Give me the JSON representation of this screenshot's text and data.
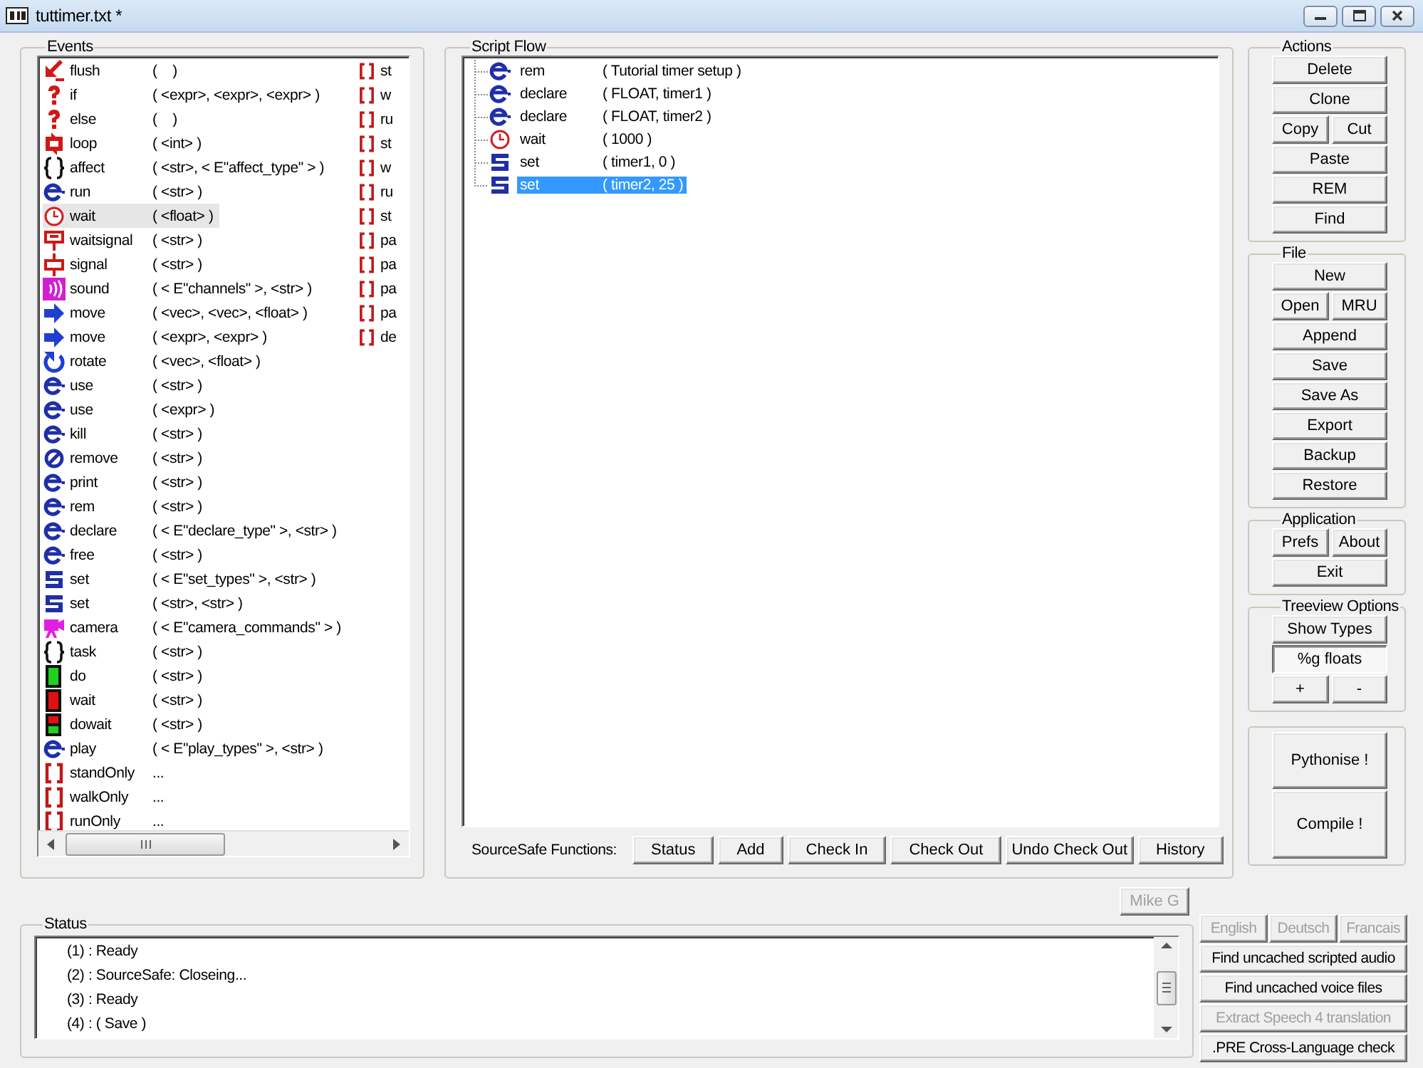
{
  "window": {
    "title": "tuttimer.txt *"
  },
  "events": {
    "title": "Events",
    "columns": [
      {
        "items": [
          {
            "kind": "flush",
            "name": "flush",
            "args": "(    )",
            "selected": false
          },
          {
            "kind": "question",
            "name": "if",
            "args": "( <expr>, <expr>, <expr> )",
            "selected": false
          },
          {
            "kind": "question",
            "name": "else",
            "args": "(    )",
            "selected": false
          },
          {
            "kind": "loop",
            "name": "loop",
            "args": "( <int> )",
            "selected": false
          },
          {
            "kind": "braces",
            "name": "affect",
            "args": "( <str>, < E\"affect_type\" > )",
            "selected": false
          },
          {
            "kind": "e",
            "name": "run",
            "args": "( <str> )",
            "selected": false
          },
          {
            "kind": "clock",
            "name": "wait",
            "args": "( <float> )",
            "selected": true
          },
          {
            "kind": "waitsignal",
            "name": "waitsignal",
            "args": "( <str> )",
            "selected": false
          },
          {
            "kind": "signal",
            "name": "signal",
            "args": "( <str> )",
            "selected": false
          },
          {
            "kind": "sound",
            "name": "sound",
            "args": "( < E\"channels\" >, <str> )",
            "selected": false
          },
          {
            "kind": "arrow",
            "name": "move",
            "args": "( <vec>, <vec>, <float> )",
            "selected": false
          },
          {
            "kind": "arrow",
            "name": "move",
            "args": "( <expr>, <expr> )",
            "selected": false
          },
          {
            "kind": "rotate",
            "name": "rotate",
            "args": "( <vec>, <float> )",
            "selected": false
          },
          {
            "kind": "e",
            "name": "use",
            "args": "( <str> )",
            "selected": false
          },
          {
            "kind": "e",
            "name": "use",
            "args": "( <expr> )",
            "selected": false
          },
          {
            "kind": "e",
            "name": "kill",
            "args": "( <str> )",
            "selected": false
          },
          {
            "kind": "remove",
            "name": "remove",
            "args": "( <str> )",
            "selected": false
          },
          {
            "kind": "e",
            "name": "print",
            "args": "( <str> )",
            "selected": false
          },
          {
            "kind": "e",
            "name": "rem",
            "args": "( <str> )",
            "selected": false
          },
          {
            "kind": "e",
            "name": "declare",
            "args": "( < E\"declare_type\" >, <str> )",
            "selected": false
          },
          {
            "kind": "e",
            "name": "free",
            "args": "( <str> )",
            "selected": false
          },
          {
            "kind": "set",
            "name": "set",
            "args": "( < E\"set_types\" >, <str> )",
            "selected": false
          },
          {
            "kind": "set",
            "name": "set",
            "args": "( <str>, <str> )",
            "selected": false
          },
          {
            "kind": "camera",
            "name": "camera",
            "args": "( < E\"camera_commands\" > )",
            "selected": false
          },
          {
            "kind": "braces",
            "name": "task",
            "args": "( <str> )",
            "selected": false
          },
          {
            "kind": "go",
            "name": "do",
            "args": "( <str> )",
            "selected": false
          },
          {
            "kind": "stop",
            "name": "wait",
            "args": "( <str> )",
            "selected": false
          },
          {
            "kind": "gostop",
            "name": "dowait",
            "args": "( <str> )",
            "selected": false
          },
          {
            "kind": "e",
            "name": "play",
            "args": "( < E\"play_types\" >, <str> )",
            "selected": false
          },
          {
            "kind": "bracket",
            "name": "standOnly",
            "args": "...",
            "selected": false
          },
          {
            "kind": "bracket",
            "name": "walkOnly",
            "args": "...",
            "selected": false
          },
          {
            "kind": "bracket",
            "name": "runOnly",
            "args": "...",
            "selected": false
          }
        ]
      },
      {
        "items": [
          {
            "kind": "bracket",
            "name": "st",
            "selected": false
          },
          {
            "kind": "bracket",
            "name": "w",
            "selected": false
          },
          {
            "kind": "bracket",
            "name": "ru",
            "selected": false
          },
          {
            "kind": "bracket",
            "name": "st",
            "selected": false
          },
          {
            "kind": "bracket",
            "name": "w",
            "selected": false
          },
          {
            "kind": "bracket",
            "name": "ru",
            "selected": false
          },
          {
            "kind": "bracket",
            "name": "st",
            "selected": false
          },
          {
            "kind": "bracket",
            "name": "pa",
            "selected": false
          },
          {
            "kind": "bracket",
            "name": "pa",
            "selected": false
          },
          {
            "kind": "bracket",
            "name": "pa",
            "selected": false
          },
          {
            "kind": "bracket",
            "name": "pa",
            "selected": false
          },
          {
            "kind": "bracket",
            "name": "de",
            "selected": false
          }
        ]
      }
    ]
  },
  "script_flow": {
    "title": "Script Flow",
    "items": [
      {
        "kind": "e",
        "name": "rem",
        "args": "( Tutorial timer setup )",
        "selected": false
      },
      {
        "kind": "e",
        "name": "declare",
        "args": "( FLOAT, timer1 )",
        "selected": false
      },
      {
        "kind": "e",
        "name": "declare",
        "args": "( FLOAT, timer2 )",
        "selected": false
      },
      {
        "kind": "clock",
        "name": "wait",
        "args": "( 1000 )",
        "selected": false
      },
      {
        "kind": "set",
        "name": "set",
        "args": "( timer1, 0 )",
        "selected": false
      },
      {
        "kind": "set",
        "name": "set",
        "args": "( timer2, 25 )",
        "selected": true
      }
    ],
    "sourcesafe_label": "SourceSafe Functions:",
    "sourcesafe_buttons": [
      "Status",
      "Add",
      "Check In",
      "Check Out",
      "Undo Check Out",
      "History"
    ]
  },
  "side_groups": [
    {
      "title": "Actions",
      "rows": [
        [
          {
            "label": "Delete"
          }
        ],
        [
          {
            "label": "Clone"
          }
        ],
        [
          {
            "label": "Copy"
          },
          {
            "label": "Cut"
          }
        ],
        [
          {
            "label": "Paste"
          }
        ],
        [
          {
            "label": "REM"
          }
        ],
        [
          {
            "label": "Find"
          }
        ]
      ]
    },
    {
      "title": "File",
      "rows": [
        [
          {
            "label": "New"
          }
        ],
        [
          {
            "label": "Open"
          },
          {
            "label": "MRU"
          }
        ],
        [
          {
            "label": "Append"
          }
        ],
        [
          {
            "label": "Save"
          }
        ],
        [
          {
            "label": "Save As"
          }
        ],
        [
          {
            "label": "Export"
          }
        ],
        [
          {
            "label": "Backup"
          }
        ],
        [
          {
            "label": "Restore"
          }
        ]
      ]
    },
    {
      "title": "Application",
      "rows": [
        [
          {
            "label": "Prefs"
          },
          {
            "label": "About"
          }
        ],
        [
          {
            "label": "Exit"
          }
        ]
      ]
    },
    {
      "title": "Treeview Options",
      "rows": [
        [
          {
            "label": "Show Types",
            "pressed": false
          }
        ],
        [
          {
            "label": "%g floats",
            "pressed": true
          }
        ],
        [
          {
            "label": "+",
            "pressed": false
          },
          {
            "label": "-",
            "pressed": false
          }
        ]
      ]
    }
  ],
  "build_buttons": [
    "Pythonise !",
    "Compile !"
  ],
  "user_button": {
    "label": "Mike G",
    "disabled": true
  },
  "status": {
    "title": "Status",
    "lines": [
      "(1) : Ready",
      "(2) : SourceSafe: Closeing...",
      "(3) : Ready",
      "(4) : ( Save )"
    ]
  },
  "language_buttons": [
    {
      "label": "English",
      "disabled": true
    },
    {
      "label": "Deutsch",
      "disabled": true
    },
    {
      "label": "Francais",
      "disabled": true
    }
  ],
  "tool_buttons": [
    {
      "label": "Find uncached scripted audio",
      "disabled": false
    },
    {
      "label": "Find uncached voice files",
      "disabled": false
    },
    {
      "label": "Extract Speech 4 translation",
      "disabled": true
    },
    {
      "label": ".PRE Cross-Language check",
      "disabled": false
    }
  ]
}
